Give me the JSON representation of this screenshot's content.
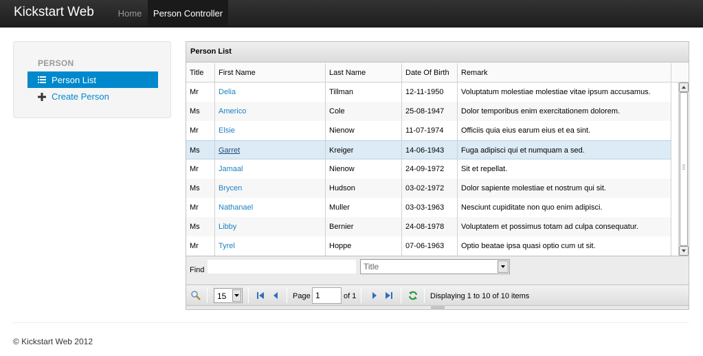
{
  "navbar": {
    "brand": "Kickstart Web",
    "items": [
      "Home",
      "Person Controller"
    ]
  },
  "sidebar": {
    "header": "PERSON",
    "items": [
      {
        "label": "Person List",
        "icon": "list-icon",
        "active": true
      },
      {
        "label": "Create Person",
        "icon": "plus-icon",
        "active": false
      }
    ]
  },
  "grid": {
    "title": "Person List",
    "columns": [
      "Title",
      "First Name",
      "Last Name",
      "Date Of Birth",
      "Remark"
    ],
    "rows": [
      [
        "Mr",
        "Delia",
        "Tillman",
        "12-11-1950",
        "Voluptatum molestiae molestiae vitae ipsum accusamus."
      ],
      [
        "Ms",
        "Americo",
        "Cole",
        "25-08-1947",
        "Dolor temporibus enim exercitationem dolorem."
      ],
      [
        "Mr",
        "Elsie",
        "Nienow",
        "11-07-1974",
        "Officiis quia eius earum eius et ea sint."
      ],
      [
        "Ms",
        "Garret",
        "Kreiger",
        "14-06-1943",
        "Fuga adipisci qui et numquam a sed."
      ],
      [
        "Mr",
        "Jamaal",
        "Nienow",
        "24-09-1972",
        "Sit et repellat."
      ],
      [
        "Ms",
        "Brycen",
        "Hudson",
        "03-02-1972",
        "Dolor sapiente molestiae et nostrum qui sit."
      ],
      [
        "Mr",
        "Nathanael",
        "Muller",
        "03-03-1963",
        "Nesciunt cupiditate non quo enim adipisci."
      ],
      [
        "Ms",
        "Libby",
        "Bernier",
        "24-08-1978",
        "Voluptatem et possimus totam ad culpa consequatur."
      ],
      [
        "Mr",
        "Tyrel",
        "Hoppe",
        "07-06-1963",
        "Optio beatae ipsa quasi optio cum ut sit."
      ]
    ],
    "selected_row": 3
  },
  "find": {
    "label": "Find",
    "value": "",
    "field": "Title"
  },
  "pager": {
    "page_size": "15",
    "page_label": "Page",
    "page": "1",
    "of_label": "of 1",
    "status": "Displaying 1 to 10 of 10 items"
  },
  "colors": {
    "accent": "#0088cc",
    "link": "#1a80c0",
    "selected_row": "#dcebf5",
    "navbar": "#222222"
  },
  "footer": {
    "text": "© Kickstart Web 2012"
  }
}
